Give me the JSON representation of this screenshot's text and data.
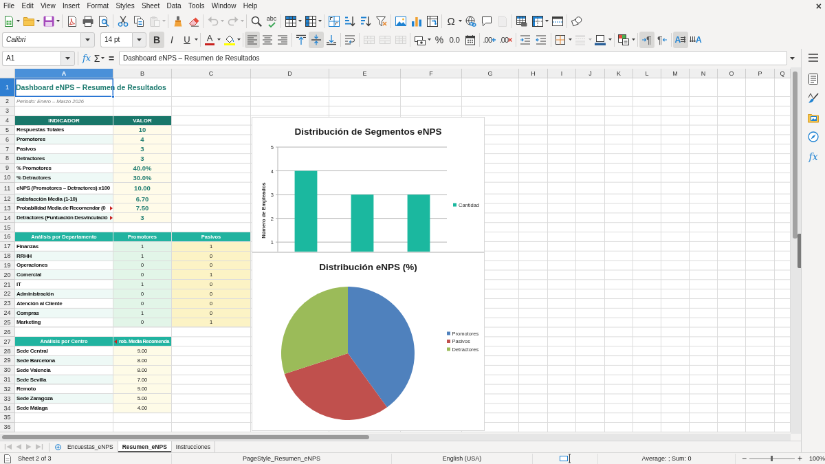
{
  "menu_bar": {
    "items": [
      "File",
      "Edit",
      "View",
      "Insert",
      "Format",
      "Styles",
      "Sheet",
      "Data",
      "Tools",
      "Window",
      "Help"
    ],
    "close_glyph": "×"
  },
  "standard_toolbar": {
    "groups": [
      [
        {
          "kind": "new",
          "dropdown": true,
          "disabled": false
        },
        {
          "kind": "open",
          "dropdown": true,
          "disabled": false
        },
        {
          "kind": "save",
          "dropdown": true,
          "disabled": false
        }
      ],
      [
        {
          "kind": "export_pdf",
          "disabled": false
        },
        {
          "kind": "print",
          "disabled": false
        },
        {
          "kind": "print_preview",
          "disabled": false
        }
      ],
      [
        {
          "kind": "cut",
          "disabled": false
        },
        {
          "kind": "copy",
          "disabled": false
        },
        {
          "kind": "paste",
          "dropdown": true,
          "disabled": true
        }
      ],
      [
        {
          "kind": "clone_formatting",
          "disabled": false
        },
        {
          "kind": "clear_formatting",
          "disabled": false
        }
      ],
      [
        {
          "kind": "undo",
          "dropdown": true,
          "disabled": true
        },
        {
          "kind": "redo",
          "dropdown": true,
          "disabled": true
        }
      ],
      [
        {
          "kind": "find_replace",
          "disabled": false
        },
        {
          "kind": "spelling",
          "glyph": "abc",
          "disabled": false
        }
      ],
      [
        {
          "kind": "rows",
          "dropdown": true,
          "disabled": false
        },
        {
          "kind": "columns",
          "dropdown": true,
          "disabled": false
        }
      ],
      [
        {
          "kind": "sort",
          "disabled": false
        },
        {
          "kind": "sort_ascending",
          "disabled": false
        },
        {
          "kind": "sort_descending",
          "disabled": false
        },
        {
          "kind": "autofilter",
          "disabled": false
        }
      ],
      [
        {
          "kind": "image",
          "disabled": false
        },
        {
          "kind": "chart",
          "disabled": false
        },
        {
          "kind": "pivot_table",
          "disabled": false
        }
      ],
      [
        {
          "kind": "special_character",
          "glyph": "Ω",
          "dropdown": true,
          "disabled": false
        },
        {
          "kind": "hyperlink",
          "disabled": false
        },
        {
          "kind": "comment",
          "disabled": false
        },
        {
          "kind": "header_footer",
          "disabled": true
        }
      ],
      [
        {
          "kind": "print_area",
          "disabled": false
        },
        {
          "kind": "freeze",
          "dropdown": true,
          "disabled": false
        },
        {
          "kind": "split_window",
          "disabled": false
        }
      ],
      [
        {
          "kind": "draw_functions",
          "disabled": false
        }
      ]
    ]
  },
  "formatting_toolbar": {
    "font_name": {
      "value": "Calibri"
    },
    "font_size": {
      "value": "14 pt"
    },
    "groups": [
      [
        {
          "kind": "bold",
          "glyph": "B",
          "on": true,
          "disabled": false
        },
        {
          "kind": "italic",
          "glyph": "I",
          "on": false,
          "disabled": false
        },
        {
          "kind": "underline",
          "glyph": "U",
          "dropdown": true,
          "on": false,
          "disabled": false
        }
      ],
      [
        {
          "kind": "font_color",
          "glyph": "A",
          "color": "#c9211e",
          "dropdown": true,
          "disabled": false
        },
        {
          "kind": "highlight",
          "color": "#ffff00",
          "dropdown": true,
          "disabled": false
        }
      ],
      [
        {
          "kind": "align_left",
          "on": true,
          "disabled": false
        },
        {
          "kind": "align_center",
          "on": false,
          "disabled": false
        },
        {
          "kind": "align_right",
          "on": false,
          "disabled": false
        }
      ],
      [
        {
          "kind": "align_top",
          "on": false,
          "disabled": false
        },
        {
          "kind": "align_middle",
          "on": true,
          "disabled": false
        },
        {
          "kind": "align_bottom",
          "on": false,
          "disabled": false
        }
      ],
      [
        {
          "kind": "wrap_text",
          "on": false,
          "disabled": false
        }
      ],
      [
        {
          "kind": "merge_center",
          "disabled": true
        },
        {
          "kind": "merge",
          "disabled": true
        },
        {
          "kind": "unmerge",
          "disabled": true
        }
      ],
      [
        {
          "kind": "currency",
          "dropdown": true,
          "disabled": false
        },
        {
          "kind": "percent",
          "glyph": "%",
          "disabled": false
        },
        {
          "kind": "number",
          "glyph": "0.0",
          "disabled": false
        },
        {
          "kind": "date",
          "disabled": false
        }
      ],
      [
        {
          "kind": "add_decimal",
          "glyph": ".00",
          "disabled": false
        },
        {
          "kind": "delete_decimal",
          "glyph": ".00",
          "disabled": false
        }
      ],
      [
        {
          "kind": "indent_increase",
          "disabled": false
        },
        {
          "kind": "indent_decrease",
          "disabled": false
        }
      ],
      [
        {
          "kind": "borders",
          "dropdown": true,
          "disabled": false
        },
        {
          "kind": "border_style",
          "dropdown": true,
          "disabled": true
        },
        {
          "kind": "border_color",
          "color": "#2a6099",
          "dropdown": true,
          "disabled": false
        }
      ],
      [
        {
          "kind": "conditional",
          "dropdown": true,
          "disabled": false
        }
      ],
      [
        {
          "kind": "ltr",
          "glyph": "¶",
          "on": true,
          "disabled": false
        },
        {
          "kind": "rtl",
          "glyph": "¶",
          "on": false,
          "disabled": false
        }
      ],
      [
        {
          "kind": "text_horizontal",
          "glyph": "A",
          "on": true,
          "disabled": false
        },
        {
          "kind": "text_vertical",
          "glyph": "A",
          "on": false,
          "disabled": false
        }
      ]
    ]
  },
  "formula_bar": {
    "name_box": {
      "value": "A1"
    },
    "function_glyph": "fx",
    "sum_glyph": "Σ",
    "equals_glyph": "=",
    "input": {
      "value": "Dashboard eNPS – Resumen de Resultados"
    }
  },
  "sidebar": {
    "tabs": [
      {
        "kind": "properties",
        "selected": false
      },
      {
        "kind": "styles",
        "selected": false
      },
      {
        "kind": "gallery",
        "selected": false
      },
      {
        "kind": "navigator",
        "selected": false
      },
      {
        "kind": "functions",
        "glyph": "fx",
        "selected": false
      }
    ]
  },
  "sheet": {
    "columns": [
      {
        "label": "A",
        "selected": true
      },
      {
        "label": "B",
        "selected": false
      },
      {
        "label": "C",
        "selected": false
      },
      {
        "label": "D",
        "selected": false
      },
      {
        "label": "E",
        "selected": false
      },
      {
        "label": "F",
        "selected": false
      },
      {
        "label": "G",
        "selected": false
      },
      {
        "label": "H",
        "selected": false
      },
      {
        "label": "I",
        "selected": false
      },
      {
        "label": "J",
        "selected": false
      },
      {
        "label": "K",
        "selected": false
      },
      {
        "label": "L",
        "selected": false
      },
      {
        "label": "M",
        "selected": false
      },
      {
        "label": "N",
        "selected": false
      },
      {
        "label": "O",
        "selected": false
      },
      {
        "label": "P",
        "selected": false
      },
      {
        "label": "Q",
        "selected": false
      }
    ],
    "rows": [
      {
        "label": "1",
        "selected": true,
        "cells": [
          {
            "kind": "title",
            "text": "Dashboard eNPS – Resumen de Resultados",
            "selected": true
          }
        ]
      },
      {
        "label": "2",
        "selected": false,
        "cells": [
          {
            "kind": "period",
            "text": "Periodo: Enero – Marzo 2026",
            "selected": false
          }
        ]
      },
      {
        "label": "3",
        "selected": false
      },
      {
        "label": "4",
        "selected": false,
        "cells": [
          {
            "kind": "header_dark",
            "text": "INDICADOR",
            "selected": false
          },
          {
            "kind": "header_dark",
            "text": "VALOR",
            "selected": false
          }
        ]
      },
      {
        "label": "5",
        "selected": false,
        "cells": [
          {
            "kind": "label",
            "text": "Respuestas Totales",
            "shaded": false,
            "selected": false
          },
          {
            "kind": "value",
            "text": "10",
            "selected": false
          }
        ]
      },
      {
        "label": "6",
        "selected": false,
        "cells": [
          {
            "kind": "label",
            "text": "Promotores",
            "shaded": true,
            "selected": false
          },
          {
            "kind": "value",
            "text": "4",
            "selected": false
          }
        ]
      },
      {
        "label": "7",
        "selected": false,
        "cells": [
          {
            "kind": "label",
            "text": "Pasivos",
            "shaded": false,
            "selected": false
          },
          {
            "kind": "value",
            "text": "3",
            "selected": false
          }
        ]
      },
      {
        "label": "8",
        "selected": false,
        "cells": [
          {
            "kind": "label",
            "text": "Detractores",
            "shaded": true,
            "selected": false
          },
          {
            "kind": "value",
            "text": "3",
            "selected": false
          }
        ]
      },
      {
        "label": "9",
        "selected": false,
        "cells": [
          {
            "kind": "label",
            "text": "% Promotores",
            "shaded": false,
            "selected": false
          },
          {
            "kind": "value",
            "text": "40.0%",
            "selected": false
          }
        ]
      },
      {
        "label": "10",
        "selected": false,
        "cells": [
          {
            "kind": "label",
            "text": "% Detractores",
            "shaded": true,
            "selected": false
          },
          {
            "kind": "value",
            "text": "30.0%",
            "selected": false
          }
        ]
      },
      {
        "label": "11",
        "selected": false,
        "cells": [
          {
            "kind": "label",
            "text": "eNPS (Promotores – Detractores) x100",
            "shaded": false,
            "selected": false
          },
          {
            "kind": "value",
            "text": "10.00",
            "selected": false
          }
        ]
      },
      {
        "label": "12",
        "selected": false,
        "cells": [
          {
            "kind": "label",
            "text": "Satisfacción Media (1-10)",
            "shaded": true,
            "selected": false
          },
          {
            "kind": "value",
            "text": "6.70",
            "selected": false
          }
        ]
      },
      {
        "label": "13",
        "selected": false,
        "cells": [
          {
            "kind": "label",
            "text": "Probabilidad Media de Recomendar (0",
            "shaded": false,
            "clipped": true,
            "selected": false
          },
          {
            "kind": "value",
            "text": "7.50",
            "selected": false
          }
        ]
      },
      {
        "label": "14",
        "selected": false,
        "cells": [
          {
            "kind": "label",
            "text": "Detractores (Puntuación Desvinculació",
            "shaded": true,
            "clipped": true,
            "selected": false
          },
          {
            "kind": "value",
            "text": "3",
            "selected": false
          }
        ]
      },
      {
        "label": "15",
        "selected": false
      },
      {
        "label": "16",
        "selected": false,
        "cells": [
          {
            "kind": "header_teal",
            "text": "Análisis por Departamento",
            "selected": false
          },
          {
            "kind": "header_teal",
            "text": "Promotores",
            "selected": false
          },
          {
            "kind": "header_teal",
            "text": "Pasivos",
            "selected": false
          }
        ]
      },
      {
        "label": "17",
        "selected": false,
        "cells": [
          {
            "kind": "label",
            "text": "Finanzas",
            "shaded": false,
            "selected": false
          },
          {
            "kind": "count_green",
            "text": "1",
            "selected": false
          },
          {
            "kind": "count_yellow",
            "text": "1",
            "selected": false
          }
        ]
      },
      {
        "label": "18",
        "selected": false,
        "cells": [
          {
            "kind": "label",
            "text": "RRHH",
            "shaded": true,
            "selected": false
          },
          {
            "kind": "count_green",
            "text": "1",
            "selected": false
          },
          {
            "kind": "count_yellow",
            "text": "0",
            "selected": false
          }
        ]
      },
      {
        "label": "19",
        "selected": false,
        "cells": [
          {
            "kind": "label",
            "text": "Operaciones",
            "shaded": false,
            "selected": false
          },
          {
            "kind": "count_green",
            "text": "0",
            "selected": false
          },
          {
            "kind": "count_yellow",
            "text": "0",
            "selected": false
          }
        ]
      },
      {
        "label": "20",
        "selected": false,
        "cells": [
          {
            "kind": "label",
            "text": "Comercial",
            "shaded": true,
            "selected": false
          },
          {
            "kind": "count_green",
            "text": "0",
            "selected": false
          },
          {
            "kind": "count_yellow",
            "text": "1",
            "selected": false
          }
        ]
      },
      {
        "label": "21",
        "selected": false,
        "cells": [
          {
            "kind": "label",
            "text": "IT",
            "shaded": false,
            "selected": false
          },
          {
            "kind": "count_green",
            "text": "1",
            "selected": false
          },
          {
            "kind": "count_yellow",
            "text": "0",
            "selected": false
          }
        ]
      },
      {
        "label": "22",
        "selected": false,
        "cells": [
          {
            "kind": "label",
            "text": "Administración",
            "shaded": true,
            "selected": false
          },
          {
            "kind": "count_green",
            "text": "0",
            "selected": false
          },
          {
            "kind": "count_yellow",
            "text": "0",
            "selected": false
          }
        ]
      },
      {
        "label": "23",
        "selected": false,
        "cells": [
          {
            "kind": "label",
            "text": "Atención al Cliente",
            "shaded": false,
            "selected": false
          },
          {
            "kind": "count_green",
            "text": "0",
            "selected": false
          },
          {
            "kind": "count_yellow",
            "text": "0",
            "selected": false
          }
        ]
      },
      {
        "label": "24",
        "selected": false,
        "cells": [
          {
            "kind": "label",
            "text": "Compras",
            "shaded": true,
            "selected": false
          },
          {
            "kind": "count_green",
            "text": "1",
            "selected": false
          },
          {
            "kind": "count_yellow",
            "text": "0",
            "selected": false
          }
        ]
      },
      {
        "label": "25",
        "selected": false,
        "cells": [
          {
            "kind": "label",
            "text": "Marketing",
            "shaded": false,
            "selected": false
          },
          {
            "kind": "count_green",
            "text": "0",
            "selected": false
          },
          {
            "kind": "count_yellow",
            "text": "1",
            "selected": false
          }
        ]
      },
      {
        "label": "26",
        "selected": false
      },
      {
        "label": "27",
        "selected": false,
        "cells": [
          {
            "kind": "header_teal",
            "text": "Análisis por Centro",
            "selected": false
          },
          {
            "kind": "header_teal",
            "text": "rob. Media Recomenda",
            "clipped": true,
            "selected": false
          }
        ]
      },
      {
        "label": "28",
        "selected": false,
        "cells": [
          {
            "kind": "label",
            "text": "Sede Central",
            "shaded": false,
            "selected": false
          },
          {
            "kind": "score",
            "text": "9.00",
            "selected": false
          }
        ]
      },
      {
        "label": "29",
        "selected": false,
        "cells": [
          {
            "kind": "label",
            "text": "Sede Barcelona",
            "shaded": true,
            "selected": false
          },
          {
            "kind": "score",
            "text": "8.00",
            "selected": false
          }
        ]
      },
      {
        "label": "30",
        "selected": false,
        "cells": [
          {
            "kind": "label",
            "text": "Sede Valencia",
            "shaded": false,
            "selected": false
          },
          {
            "kind": "score",
            "text": "8.00",
            "selected": false
          }
        ]
      },
      {
        "label": "31",
        "selected": false,
        "cells": [
          {
            "kind": "label",
            "text": "Sede Sevilla",
            "shaded": true,
            "selected": false
          },
          {
            "kind": "score",
            "text": "7.00",
            "selected": false
          }
        ]
      },
      {
        "label": "32",
        "selected": false,
        "cells": [
          {
            "kind": "label",
            "text": "Remoto",
            "shaded": false,
            "selected": false
          },
          {
            "kind": "score",
            "text": "9.00",
            "selected": false
          }
        ]
      },
      {
        "label": "33",
        "selected": false,
        "cells": [
          {
            "kind": "label",
            "text": "Sede Zaragoza",
            "shaded": true,
            "selected": false
          },
          {
            "kind": "score",
            "text": "5.00",
            "selected": false
          }
        ]
      },
      {
        "label": "34",
        "selected": false,
        "cells": [
          {
            "kind": "label",
            "text": "Sede Málaga",
            "shaded": false,
            "selected": false
          },
          {
            "kind": "score",
            "text": "4.00",
            "selected": false
          }
        ]
      },
      {
        "label": "35",
        "selected": false
      },
      {
        "label": "36",
        "selected": false
      }
    ],
    "charts": [
      {
        "chart_data": {
          "type": "bar",
          "title": "Distribución de Segmentos eNPS",
          "ylabel": "Número de Empleados",
          "series": [
            {
              "name": "Cantidad",
              "color": "#1bb89f",
              "values": [
                4,
                3,
                3
              ]
            }
          ],
          "ylim": [
            0.6,
            5
          ],
          "yticks": [
            1,
            2,
            3,
            4,
            5
          ],
          "grid": true,
          "legend": "right"
        }
      },
      {
        "chart_data": {
          "type": "pie",
          "title": "Distribución eNPS (%)",
          "categories": [
            "Promotores",
            "Pasivos",
            "Detractores"
          ],
          "values": [
            40,
            30,
            30
          ],
          "colors": [
            "#4f81bd",
            "#c0504d",
            "#9bbb59"
          ],
          "legend": "right"
        }
      }
    ]
  },
  "sheet_tabs": {
    "nav_buttons": [
      {
        "kind": "first",
        "disabled": true
      },
      {
        "kind": "previous",
        "disabled": true
      },
      {
        "kind": "next",
        "disabled": true
      },
      {
        "kind": "last",
        "disabled": true
      }
    ],
    "tabs": [
      {
        "label": "Encuestas_eNPS",
        "selected": false
      },
      {
        "label": "Resumen_eNPS",
        "selected": true
      },
      {
        "label": "Instrucciones",
        "selected": false
      }
    ]
  },
  "status_bar": {
    "sheet_position": "Sheet 2 of 3",
    "page_style": "PageStyle_Resumen_eNPS",
    "language": "English (USA)",
    "selection_summary": "Average: ; Sum: 0",
    "zoom": {
      "out_glyph": "−",
      "in_glyph": "+",
      "level": 0.5,
      "reading": "100%"
    }
  }
}
